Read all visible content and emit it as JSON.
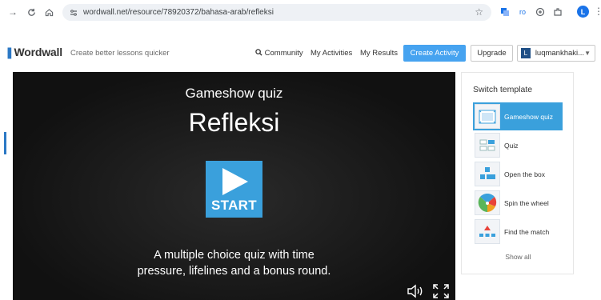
{
  "browser": {
    "url": "wordwall.net/resource/78920372/bahasa-arab/refleksi",
    "avatar_letter": "L",
    "ext_label": "ro"
  },
  "site": {
    "logo": "Wordwall",
    "tagline": "Create better lessons quicker",
    "nav": [
      "Community",
      "My Activities",
      "My Results"
    ],
    "create_label": "Create Activity",
    "upgrade_label": "Upgrade",
    "user_initial": "L",
    "user_name": "luqmankhaki..."
  },
  "game": {
    "subtitle": "Gameshow quiz",
    "title": "Refleksi",
    "start_label": "START",
    "description_line1": "A multiple choice quiz with time",
    "description_line2": "pressure, lifelines and a bonus round."
  },
  "switch": {
    "title": "Switch template",
    "templates": [
      {
        "label": "Gameshow quiz"
      },
      {
        "label": "Quiz"
      },
      {
        "label": "Open the box"
      },
      {
        "label": "Spin the wheel"
      },
      {
        "label": "Find the match"
      }
    ],
    "show_all": "Show all"
  },
  "colors": {
    "accent": "#3aa0dc",
    "create_button": "#46a3f0",
    "stage_bg": "#111111"
  }
}
